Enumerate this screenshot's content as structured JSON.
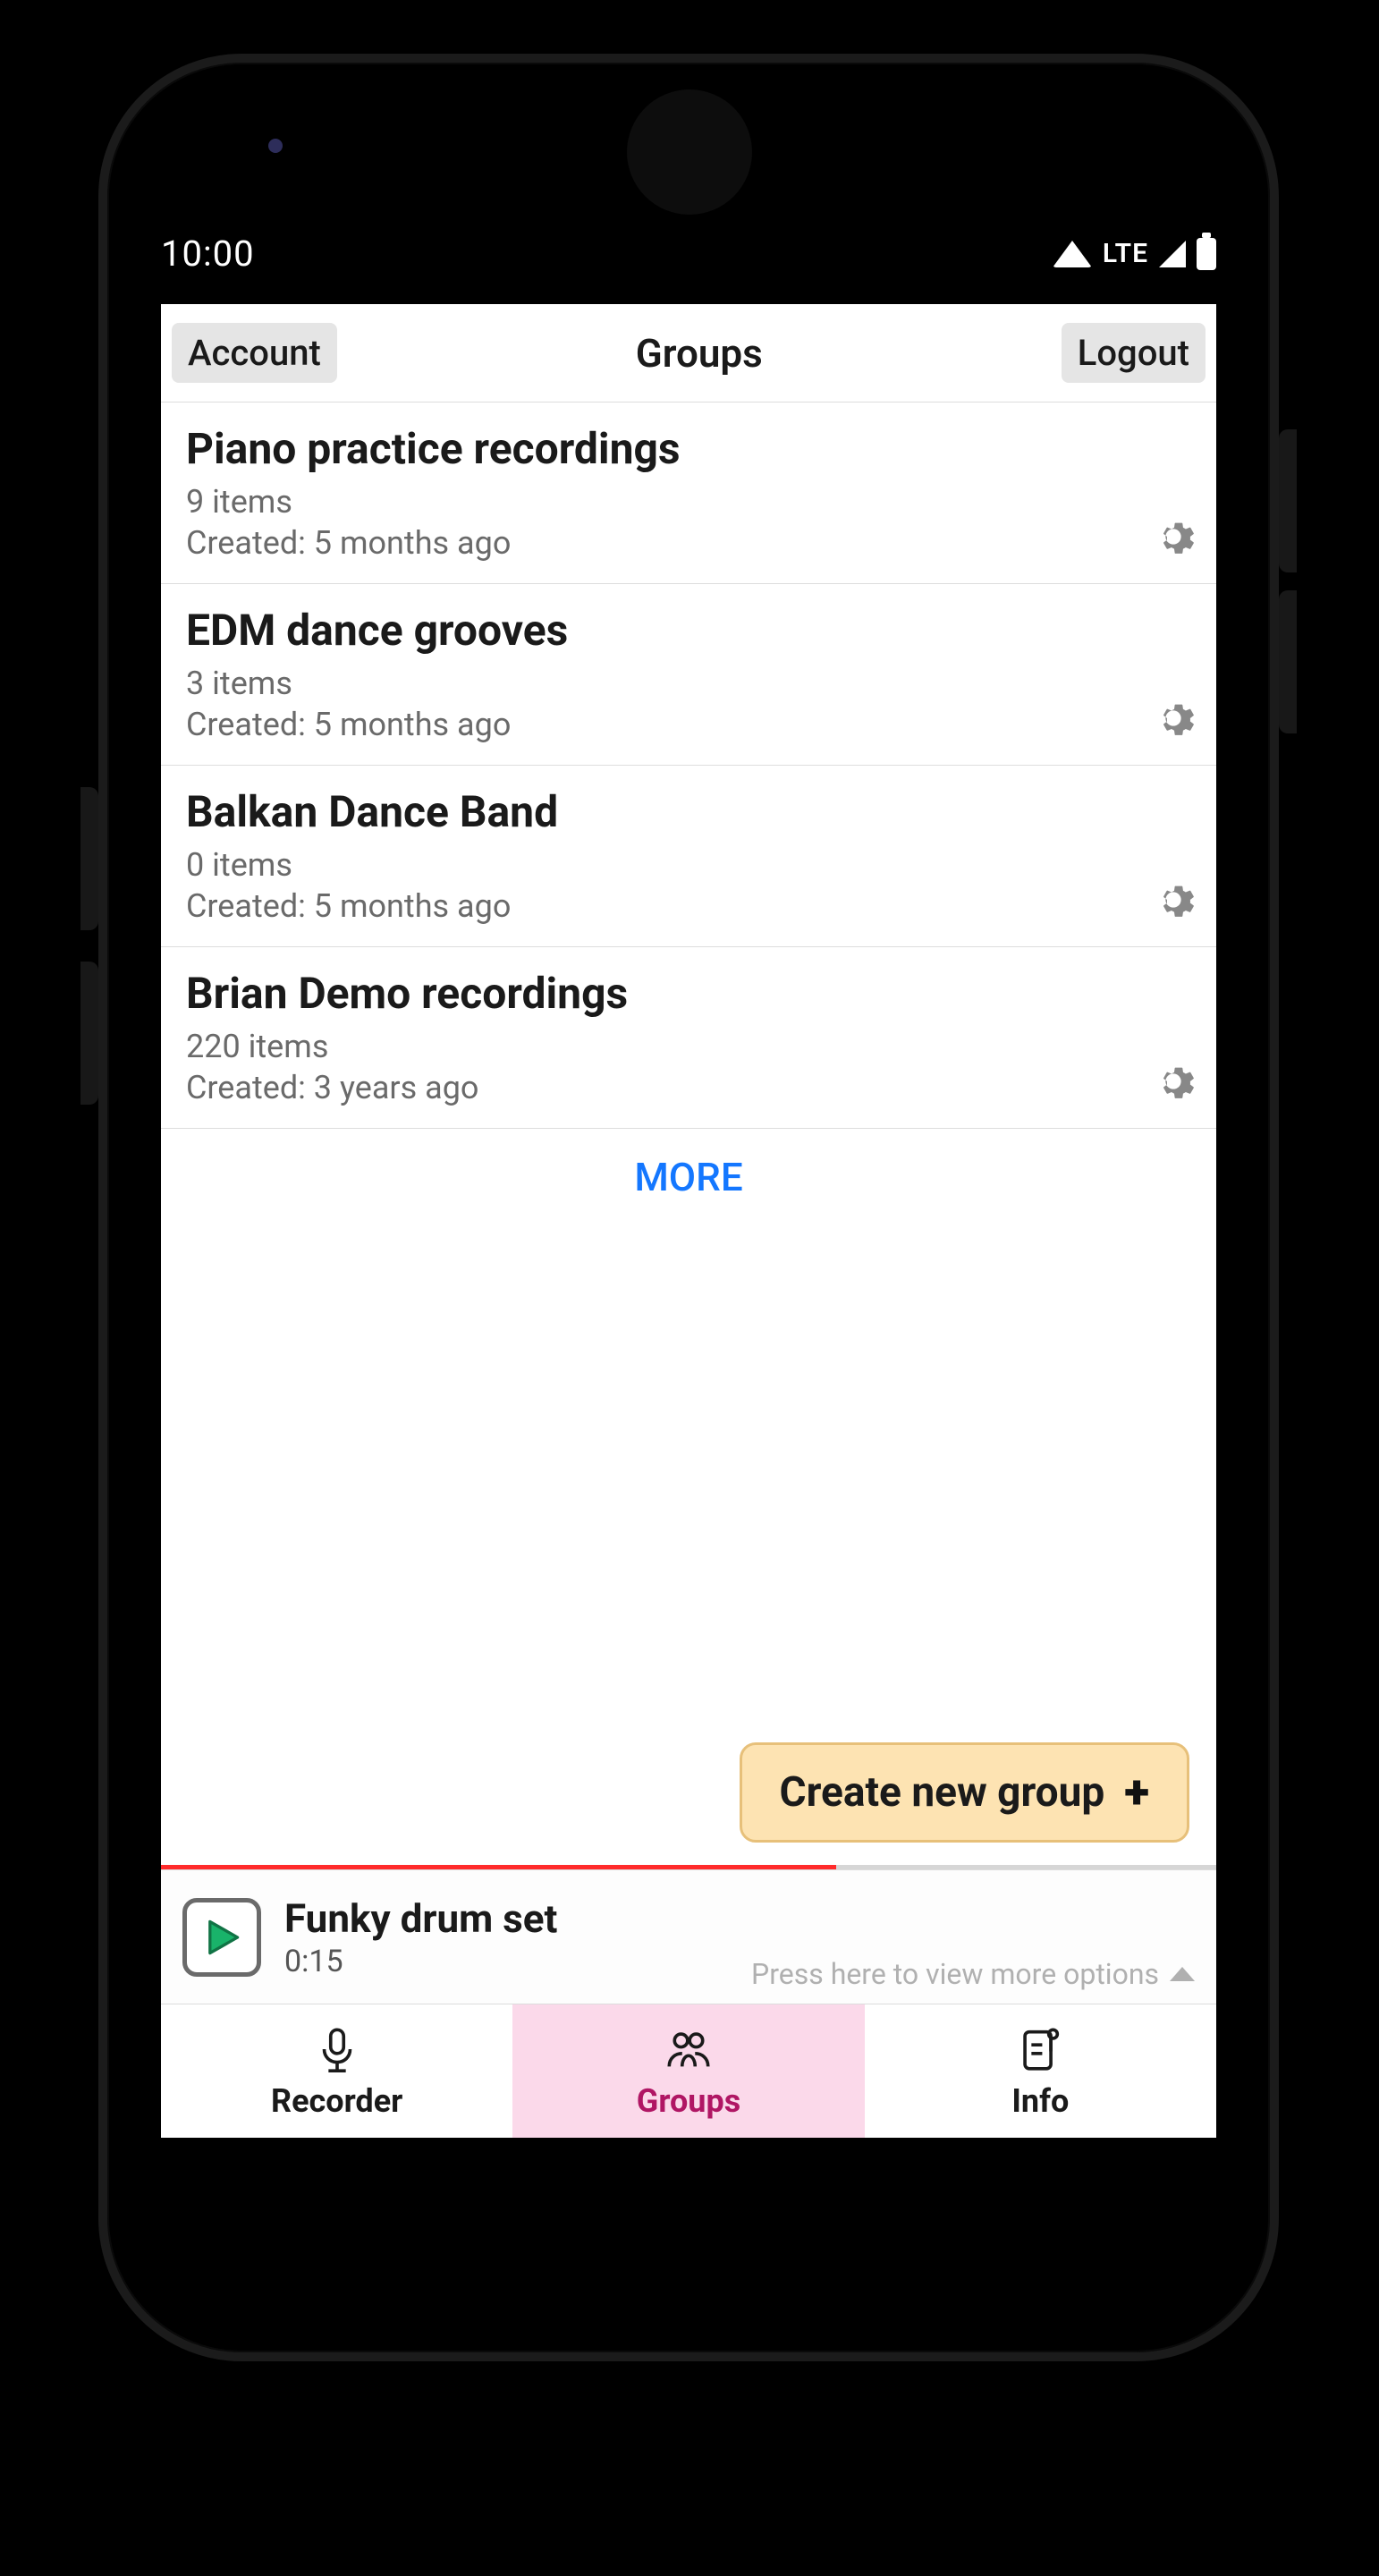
{
  "status": {
    "time": "10:00",
    "network": "LTE"
  },
  "appbar": {
    "account": "Account",
    "title": "Groups",
    "logout": "Logout"
  },
  "groups": [
    {
      "title": "Piano practice recordings",
      "items": "9 items",
      "created": "Created: 5 months ago"
    },
    {
      "title": "EDM dance grooves",
      "items": "3 items",
      "created": "Created: 5 months ago"
    },
    {
      "title": "Balkan Dance Band",
      "items": "0 items",
      "created": "Created: 5 months ago"
    },
    {
      "title": "Brian Demo recordings",
      "items": "220 items",
      "created": "Created: 3 years ago"
    }
  ],
  "more_label": "MORE",
  "create_label": "Create new group",
  "player": {
    "track_title": "Funky drum set",
    "track_time": "0:15",
    "hint": "Press here to view more options"
  },
  "tabs": {
    "recorder": "Recorder",
    "groups": "Groups",
    "info": "Info"
  }
}
